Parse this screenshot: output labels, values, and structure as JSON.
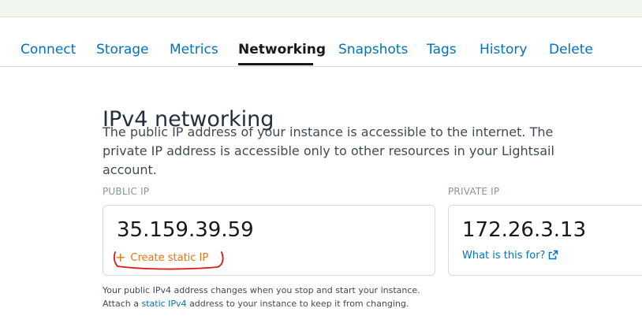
{
  "tabs": [
    {
      "label": "Connect",
      "active": false
    },
    {
      "label": "Storage",
      "active": false
    },
    {
      "label": "Metrics",
      "active": false
    },
    {
      "label": "Networking",
      "active": true
    },
    {
      "label": "Snapshots",
      "active": false
    },
    {
      "label": "Tags",
      "active": false
    },
    {
      "label": "History",
      "active": false
    },
    {
      "label": "Delete",
      "active": false
    }
  ],
  "section": {
    "title": "IPv4 networking",
    "description": "The public IP address of your instance is accessible to the internet. The private IP address is accessible only to other resources in your Lightsail account."
  },
  "public_ip": {
    "label": "PUBLIC IP",
    "value": "35.159.39.59",
    "action_label": "Create static IP",
    "action_icon": "plus-icon"
  },
  "private_ip": {
    "label": "PRIVATE IP",
    "value": "172.26.3.13",
    "link_label": "What is this for?",
    "link_icon": "external-link-icon"
  },
  "footnote": {
    "line1": "Your public IPv4 address changes when you stop and start your instance.",
    "line2_prefix": "Attach a",
    "line2_link": "static IPv4",
    "line2_suffix": "address to your instance to keep it from changing."
  },
  "colors": {
    "link": "#0073bb",
    "accent_orange": "#ec7211",
    "annotation_red": "#d7191c"
  }
}
